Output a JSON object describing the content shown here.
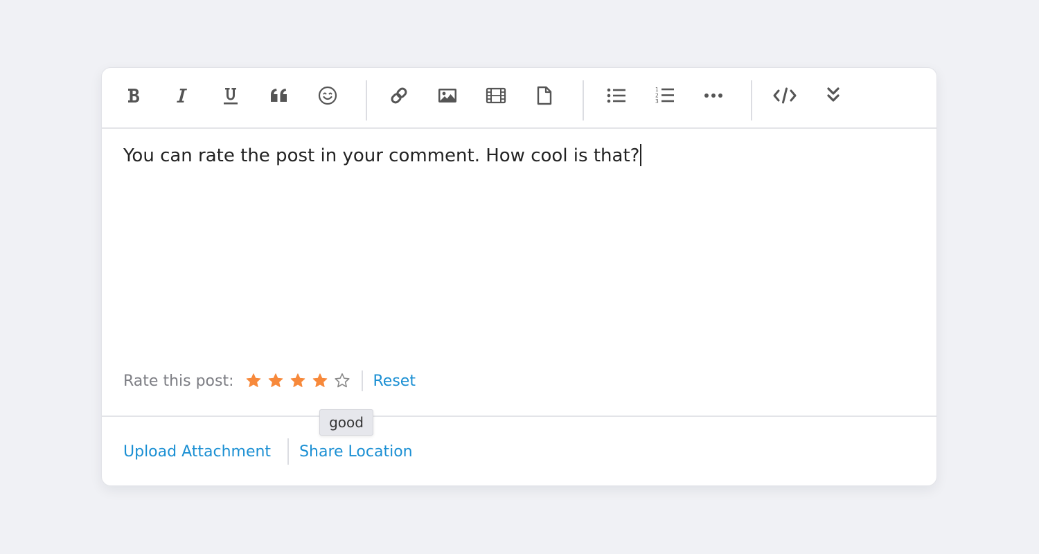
{
  "toolbar": {
    "buttons": [
      {
        "name": "bold-icon",
        "label": "Bold"
      },
      {
        "name": "italic-icon",
        "label": "Italic"
      },
      {
        "name": "underline-icon",
        "label": "Underline"
      },
      {
        "name": "quote-icon",
        "label": "Quote"
      },
      {
        "name": "emoji-icon",
        "label": "Emoji"
      },
      {
        "name": "link-icon",
        "label": "Link"
      },
      {
        "name": "image-icon",
        "label": "Image"
      },
      {
        "name": "video-icon",
        "label": "Video"
      },
      {
        "name": "file-icon",
        "label": "File"
      },
      {
        "name": "bulleted-list-icon",
        "label": "Bulleted list"
      },
      {
        "name": "numbered-list-icon",
        "label": "Numbered list"
      },
      {
        "name": "more-icon",
        "label": "More"
      },
      {
        "name": "code-icon",
        "label": "Code"
      },
      {
        "name": "expand-icon",
        "label": "Expand"
      }
    ],
    "icon_color": "#555555"
  },
  "editor": {
    "content": "You can rate the post in your comment. How cool is that?"
  },
  "rating": {
    "label": "Rate this post:",
    "value": 4,
    "max": 5,
    "filled_color": "#f7893b",
    "reset_label": "Reset",
    "tooltip": "good"
  },
  "footer": {
    "upload_label": "Upload Attachment",
    "location_label": "Share Location"
  },
  "colors": {
    "link": "#1a8fd3",
    "background": "#f0f1f5"
  }
}
